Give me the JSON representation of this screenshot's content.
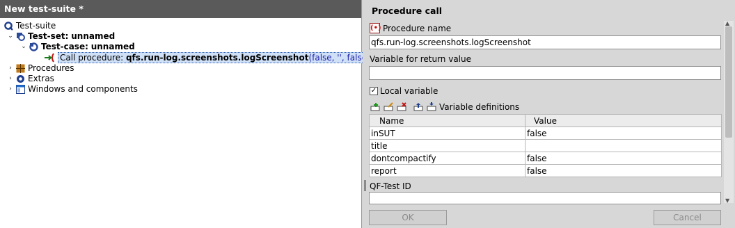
{
  "left_panel": {
    "title": "New test-suite *",
    "tree": {
      "suite_label": "Test-suite",
      "testset_prefix": "Test-set: ",
      "testset_name": "unnamed",
      "testcase_prefix": "Test-case: ",
      "testcase_name": "unnamed",
      "call_prefix": "Call procedure: ",
      "call_name": "qfs.run-log.screenshots.logScreenshot",
      "call_args": "(false, '', false, false)",
      "procedures_label": "Procedures",
      "extras_label": "Extras",
      "windows_label": "Windows and components"
    }
  },
  "right_panel": {
    "title": "Procedure call",
    "procedure_name_label": "Procedure name",
    "procedure_name_value": "qfs.run-log.screenshots.logScreenshot",
    "return_var_label": "Variable for return value",
    "return_var_value": "",
    "local_variable_label": "Local variable",
    "local_variable_checked": true,
    "var_defs_label": "Variable definitions",
    "table": {
      "headers": [
        "Name",
        "Value"
      ],
      "rows": [
        {
          "name": "inSUT",
          "value": "false"
        },
        {
          "name": "title",
          "value": ""
        },
        {
          "name": "dontcompactify",
          "value": "false"
        },
        {
          "name": "report",
          "value": "false"
        }
      ]
    },
    "qftest_id_label": "QF-Test ID",
    "qftest_id_value": "",
    "ok_label": "OK",
    "cancel_label": "Cancel"
  },
  "colors": {
    "title_bar": "#5a5a5a",
    "panel_bg": "#d7d7d7",
    "selection_bg": "#cfe0f7",
    "selection_text": "#1c1ca8"
  }
}
